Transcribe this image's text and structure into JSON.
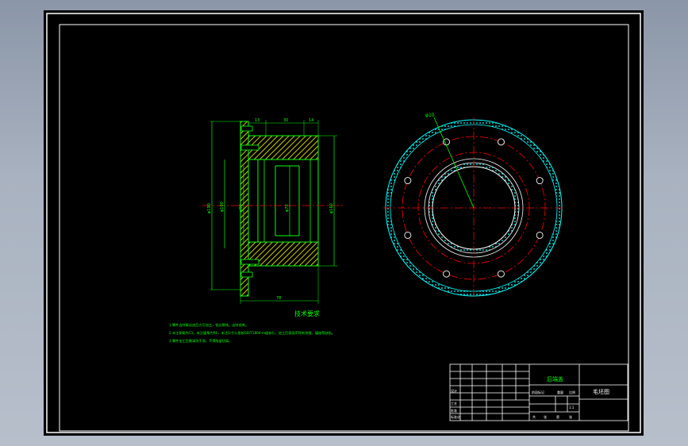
{
  "colors": {
    "background": "#000000",
    "border": "#ffffff",
    "outline": "#00ff00",
    "hatch": "#ffff00",
    "centerline": "#ff0000",
    "dimension": "#00ff00",
    "text": "#00ff00"
  },
  "section_view": {
    "dims_top": [
      "13",
      "30",
      "14"
    ],
    "dim_bottom": "78",
    "dims_vertical": [
      "φ190",
      "φ100",
      "φ80",
      "φ70",
      "φ160"
    ]
  },
  "flange_view": {
    "leader_label": "φ10",
    "bolt_holes": 8
  },
  "tech_requirements": {
    "heading": "技术要求",
    "items": [
      "1.零件去除氧化皮后方可加工，锐边倒钝，去除毛刺。",
      "2.未注倒角为C1，未注圆角为R1，未注尺寸公差按GB/T1804-m级执行，加工后表面不得有划痕、磕碰等缺陷。",
      "3.零件加工后需清洗干净，不得残留切屑。"
    ]
  },
  "title_block": {
    "part_name": "后端盖",
    "drawing_title": "毛坯图",
    "designer_label": "设计",
    "process_label": "工艺",
    "approve_label": "批准",
    "standard_label": "标准化",
    "stage_label": "阶段标记",
    "weight_label": "重量",
    "scale_label": "比例",
    "scale_value": "1:1",
    "sheet_labels": [
      "共",
      "张",
      "第",
      "张"
    ]
  }
}
